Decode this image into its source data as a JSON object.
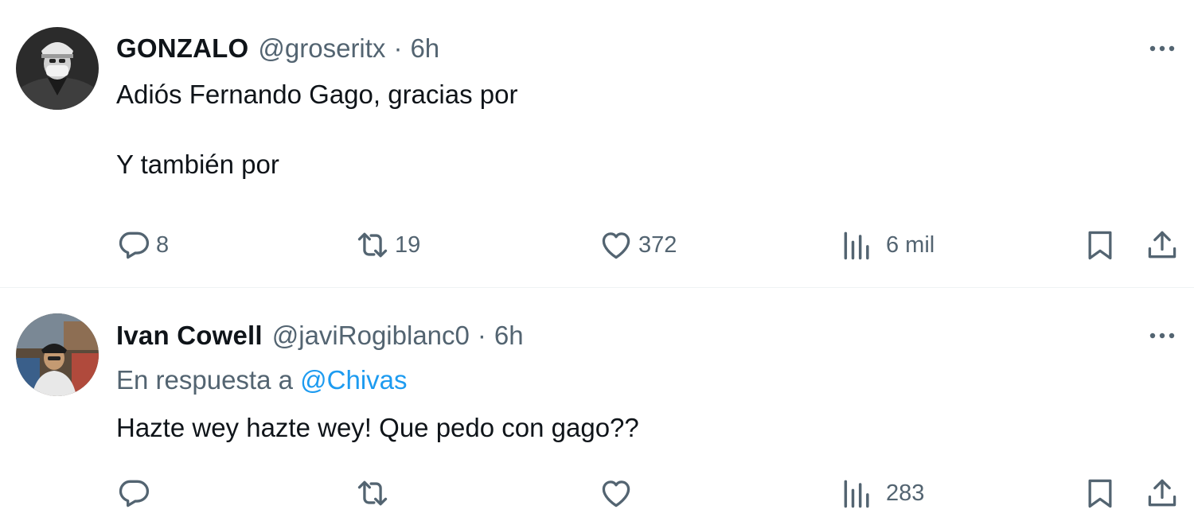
{
  "tweets": [
    {
      "author_name": "GONZALO",
      "handle": "@groseritx",
      "separator": "·",
      "time": "6h",
      "text": "Adiós Fernando Gago, gracias por\n\nY también por",
      "replying_to": null,
      "counts": {
        "replies": "8",
        "retweets": "19",
        "likes": "372",
        "views": "6 mil"
      }
    },
    {
      "author_name": "Ivan Cowell",
      "handle": "@javiRogiblanc0",
      "separator": "·",
      "time": "6h",
      "replying_prefix": "En respuesta a",
      "replying_to": "@Chivas",
      "text": "Hazte wey hazte wey! Que pedo con gago??",
      "counts": {
        "replies": "",
        "retweets": "",
        "likes": "",
        "views": "283"
      }
    }
  ],
  "icons": {
    "more": "more-horizontal-icon",
    "reply": "reply-bubble-icon",
    "retweet": "retweet-icon",
    "like": "heart-icon",
    "views": "bar-chart-icon",
    "bookmark": "bookmark-icon",
    "share": "share-upload-icon"
  },
  "colors": {
    "text": "#0f1419",
    "secondary": "#536471",
    "link": "#1d9bf0",
    "divider": "#eff3f4"
  }
}
